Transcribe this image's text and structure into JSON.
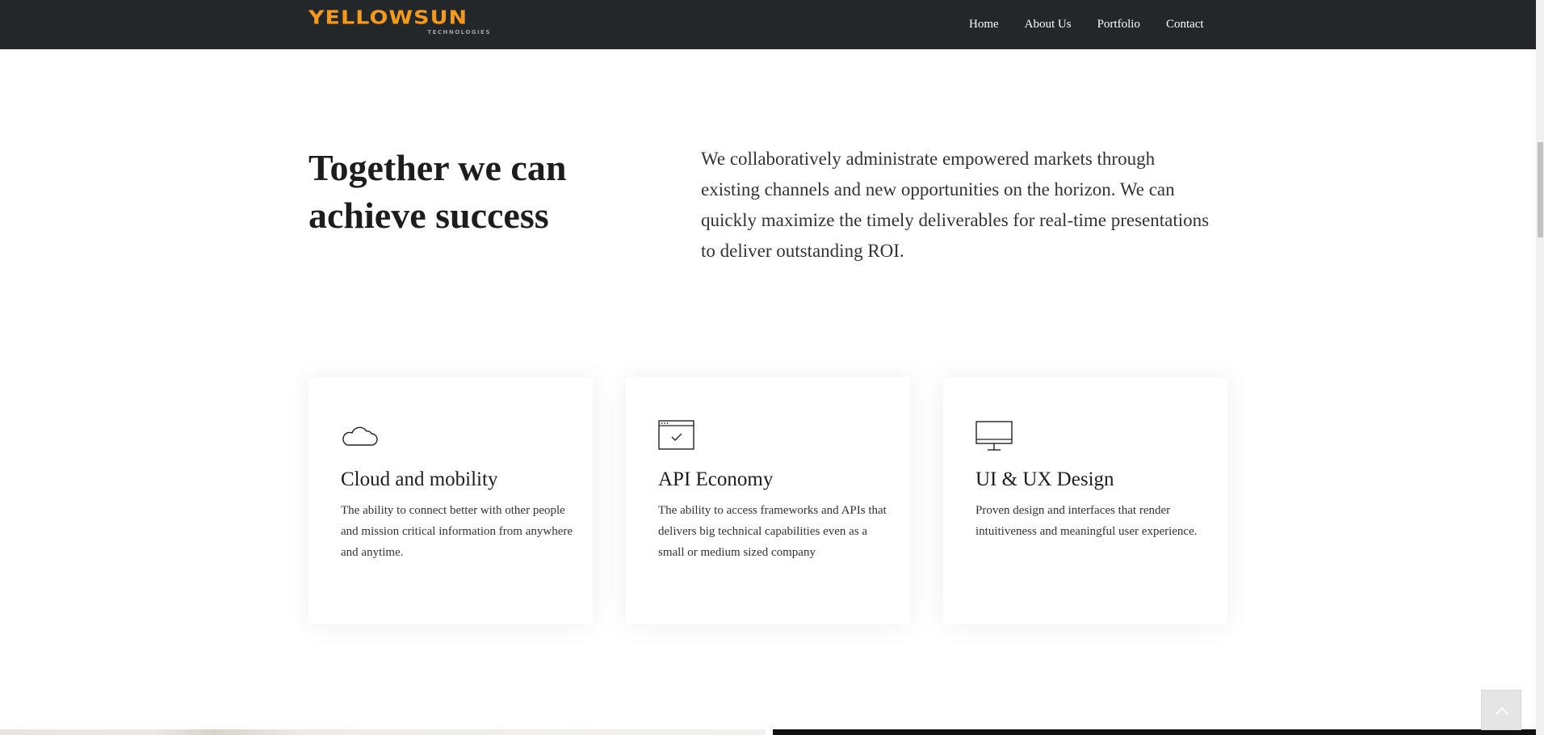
{
  "header": {
    "logo_main": "YELLOWSUN",
    "logo_sub": "TECHNOLOGIES",
    "nav": [
      {
        "label": "Home"
      },
      {
        "label": "About Us"
      },
      {
        "label": "Portfolio"
      },
      {
        "label": "Contact"
      }
    ]
  },
  "intro": {
    "title": "Together we can achieve success",
    "text": "We collaboratively administrate empowered markets through existing channels and new opportunities on the horizon. We can quickly maximize the timely deliverables for real-time presentations to deliver outstanding ROI."
  },
  "cards": [
    {
      "icon": "cloud-icon",
      "title": "Cloud and mobility",
      "description": "The ability to connect better with other people and mission critical information from anywhere and anytime."
    },
    {
      "icon": "browser-check-icon",
      "title": "API Economy",
      "description": "The ability to access frameworks and APIs that delivers big technical capabilities even as a small or medium sized company"
    },
    {
      "icon": "monitor-icon",
      "title": "UI & UX Design",
      "description": "Proven design and interfaces that render intuitiveness and meaningful user experience."
    }
  ],
  "back_to_top": {
    "icon": "chevron-up-icon"
  },
  "colors": {
    "header_bg": "#23272a",
    "logo_accent": "#f39a1c",
    "text_dark": "#1d1d1d"
  }
}
